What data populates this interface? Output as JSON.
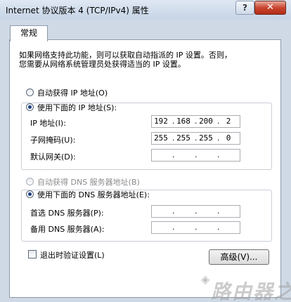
{
  "window": {
    "title": "Internet 协议版本 4 (TCP/IPv4) 属性",
    "help_label": "?",
    "close_label": "✕"
  },
  "tabs": [
    {
      "label": "常规"
    }
  ],
  "description": {
    "line1": "如果网络支持此功能，则可以获取自动指派的 IP 设置。否则，",
    "line2": "您需要从网络系统管理员处获得适当的 IP 设置。"
  },
  "ip": {
    "auto_label": "自动获得 IP 地址(O)",
    "manual_label": "使用下面的 IP 地址(S):",
    "selected": "manual",
    "fields": [
      {
        "label": "IP 地址(I):",
        "value": [
          "192",
          "168",
          "200",
          "2"
        ]
      },
      {
        "label": "子网掩码(U):",
        "value": [
          "255",
          "255",
          "255",
          "0"
        ]
      },
      {
        "label": "默认网关(D):",
        "value": [
          "",
          "",
          "",
          ""
        ]
      }
    ]
  },
  "dns": {
    "auto_label": "自动获得 DNS 服务器地址(B)",
    "manual_label": "使用下面的 DNS 服务器地址(E):",
    "selected": "manual",
    "fields": [
      {
        "label": "首选 DNS 服务器(P):",
        "value": [
          "",
          "",
          "",
          ""
        ]
      },
      {
        "label": "备用 DNS 服务器(A):",
        "value": [
          "",
          "",
          "",
          ""
        ]
      }
    ]
  },
  "validate_label": "退出时验证设置(L)",
  "advanced_label": "高级(V)...",
  "watermark": "路由器之家"
}
